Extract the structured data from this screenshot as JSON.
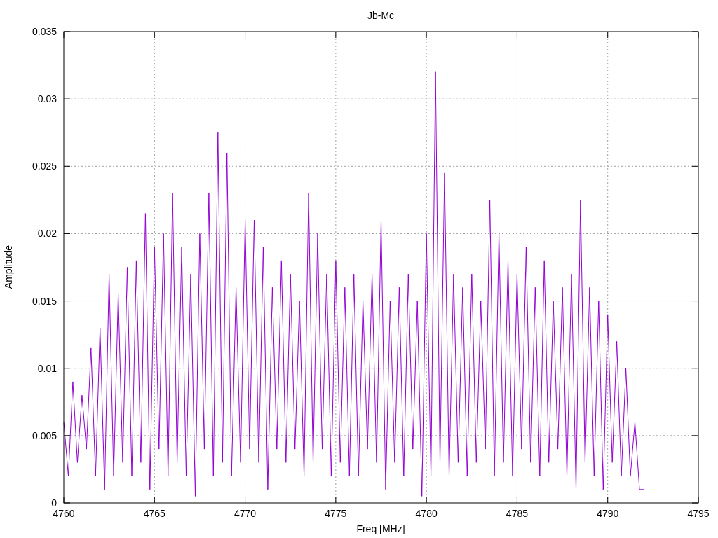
{
  "chart_data": {
    "type": "line",
    "grid": true,
    "title": "Jb-Mc",
    "xlabel": "Freq [MHz]",
    "ylabel": "Amplitude",
    "xlim": [
      4760,
      4795
    ],
    "ylim": [
      0,
      0.035
    ],
    "xticks": [
      4760,
      4765,
      4770,
      4775,
      4780,
      4785,
      4790,
      4795
    ],
    "yticks": [
      {
        "value": 0,
        "label": "0"
      },
      {
        "value": 0.005,
        "label": "0.005"
      },
      {
        "value": 0.01,
        "label": "0.01"
      },
      {
        "value": 0.015,
        "label": "0.015"
      },
      {
        "value": 0.02,
        "label": "0.02"
      },
      {
        "value": 0.025,
        "label": "0.025"
      },
      {
        "value": 0.03,
        "label": "0.03"
      },
      {
        "value": 0.035,
        "label": "0.035"
      }
    ],
    "x": [
      4760,
      4760.25,
      4760.5,
      4760.75,
      4761,
      4761.25,
      4761.5,
      4761.75,
      4762,
      4762.25,
      4762.5,
      4762.75,
      4763,
      4763.25,
      4763.5,
      4763.75,
      4764,
      4764.25,
      4764.5,
      4764.75,
      4765,
      4765.25,
      4765.5,
      4765.75,
      4766,
      4766.25,
      4766.5,
      4766.75,
      4767,
      4767.25,
      4767.5,
      4767.75,
      4768,
      4768.25,
      4768.5,
      4768.75,
      4769,
      4769.25,
      4769.5,
      4769.75,
      4770,
      4770.25,
      4770.5,
      4770.75,
      4771,
      4771.25,
      4771.5,
      4771.75,
      4772,
      4772.25,
      4772.5,
      4772.75,
      4773,
      4773.25,
      4773.5,
      4773.75,
      4774,
      4774.25,
      4774.5,
      4774.75,
      4775,
      4775.25,
      4775.5,
      4775.75,
      4776,
      4776.25,
      4776.5,
      4776.75,
      4777,
      4777.25,
      4777.5,
      4777.75,
      4778,
      4778.25,
      4778.5,
      4778.75,
      4779,
      4779.25,
      4779.5,
      4779.75,
      4780,
      4780.25,
      4780.5,
      4780.75,
      4781,
      4781.25,
      4781.5,
      4781.75,
      4782,
      4782.25,
      4782.5,
      4782.75,
      4783,
      4783.25,
      4783.5,
      4783.75,
      4784,
      4784.25,
      4784.5,
      4784.75,
      4785,
      4785.25,
      4785.5,
      4785.75,
      4786,
      4786.25,
      4786.5,
      4786.75,
      4787,
      4787.25,
      4787.5,
      4787.75,
      4788,
      4788.25,
      4788.5,
      4788.75,
      4789,
      4789.25,
      4789.5,
      4789.75,
      4790,
      4790.25,
      4790.5,
      4790.75,
      4791,
      4791.25,
      4791.5,
      4791.75,
      4792
    ],
    "series": [
      {
        "color": "#9400d3",
        "values": [
          0.006,
          0.002,
          0.009,
          0.003,
          0.008,
          0.004,
          0.0115,
          0.002,
          0.013,
          0.001,
          0.017,
          0.002,
          0.0155,
          0.003,
          0.0175,
          0.002,
          0.018,
          0.003,
          0.0215,
          0.001,
          0.019,
          0.004,
          0.02,
          0.002,
          0.023,
          0.003,
          0.019,
          0.002,
          0.017,
          0.0005,
          0.02,
          0.004,
          0.023,
          0.002,
          0.0275,
          0.003,
          0.026,
          0.002,
          0.016,
          0.003,
          0.021,
          0.004,
          0.021,
          0.003,
          0.019,
          0.001,
          0.016,
          0.004,
          0.018,
          0.003,
          0.017,
          0.004,
          0.015,
          0.002,
          0.023,
          0.003,
          0.02,
          0.004,
          0.017,
          0.002,
          0.018,
          0.003,
          0.016,
          0.002,
          0.017,
          0.002,
          0.015,
          0.004,
          0.017,
          0.003,
          0.021,
          0.001,
          0.015,
          0.003,
          0.016,
          0.002,
          0.017,
          0.004,
          0.015,
          0.0005,
          0.02,
          0.002,
          0.032,
          0.003,
          0.0245,
          0.002,
          0.017,
          0.003,
          0.016,
          0.002,
          0.017,
          0.003,
          0.015,
          0.004,
          0.0225,
          0.002,
          0.02,
          0.003,
          0.018,
          0.002,
          0.017,
          0.004,
          0.019,
          0.003,
          0.016,
          0.002,
          0.018,
          0.003,
          0.015,
          0.004,
          0.016,
          0.002,
          0.017,
          0.001,
          0.0225,
          0.003,
          0.016,
          0.002,
          0.015,
          0.001,
          0.014,
          0.003,
          0.012,
          0.002,
          0.01,
          0.002,
          0.006,
          0.001,
          0.001
        ]
      }
    ]
  }
}
